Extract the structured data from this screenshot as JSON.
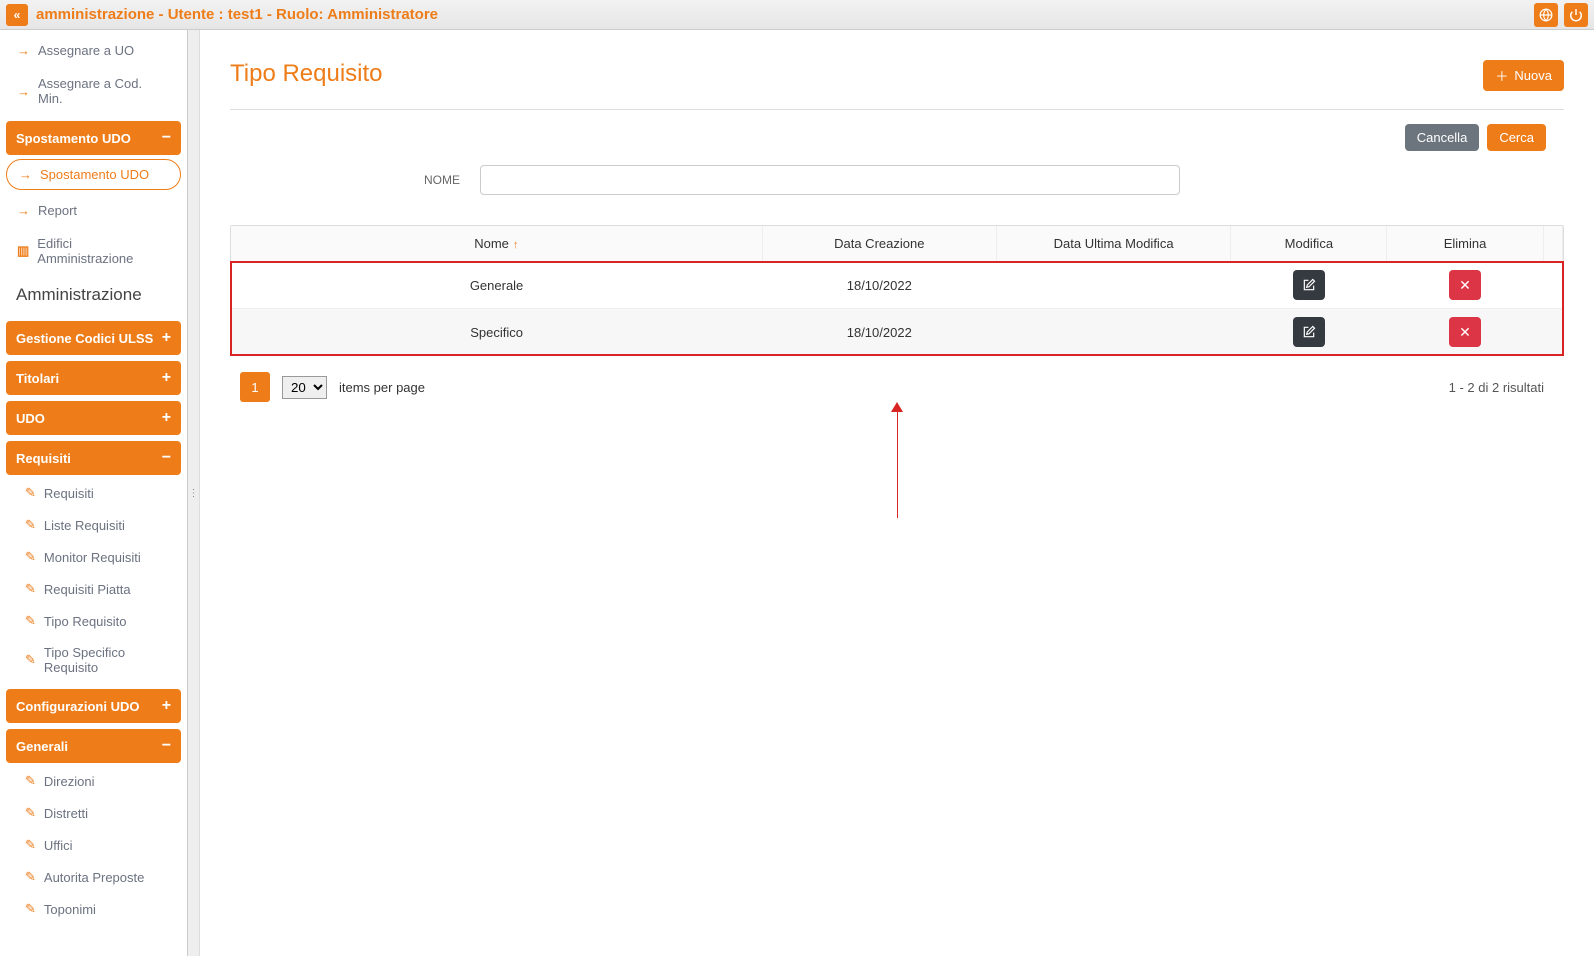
{
  "topbar": {
    "title": "amministrazione - Utente : test1 - Ruolo: Amministratore"
  },
  "sidebar": {
    "link_assegnare_uo": "Assegnare a UO",
    "link_assegnare_cod": "Assegnare a Cod. Min.",
    "head_spostamento": "Spostamento UDO",
    "link_spostamento": "Spostamento UDO",
    "link_report": "Report",
    "link_edifici": "Edifici Amministrazione",
    "head_admin": "Amministrazione",
    "head_gestione": "Gestione Codici ULSS",
    "head_titolari": "Titolari",
    "head_udo": "UDO",
    "head_requisiti": "Requisiti",
    "req_items": [
      "Requisiti",
      "Liste Requisiti",
      "Monitor Requisiti",
      "Requisiti Piatta",
      "Tipo Requisito",
      "Tipo Specifico Requisito"
    ],
    "head_config": "Configurazioni UDO",
    "head_generali": "Generali",
    "gen_items": [
      "Direzioni",
      "Distretti",
      "Uffici",
      "Autorita Preposte",
      "Toponimi"
    ]
  },
  "page": {
    "title": "Tipo Requisito",
    "btn_new": "Nuova",
    "btn_cancel": "Cancella",
    "btn_search": "Cerca",
    "filter_label": "NOME",
    "filter_value": ""
  },
  "table": {
    "cols": {
      "nome": "Nome",
      "creazione": "Data Creazione",
      "modifica": "Data Ultima Modifica",
      "edit": "Modifica",
      "del": "Elimina"
    },
    "rows": [
      {
        "nome": "Generale",
        "creazione": "18/10/2022",
        "modifica": ""
      },
      {
        "nome": "Specifico",
        "creazione": "18/10/2022",
        "modifica": ""
      }
    ]
  },
  "pager": {
    "page": "1",
    "perpage": "20",
    "perpage_label": "items per page",
    "summary": "1 - 2 di 2 risultati"
  }
}
